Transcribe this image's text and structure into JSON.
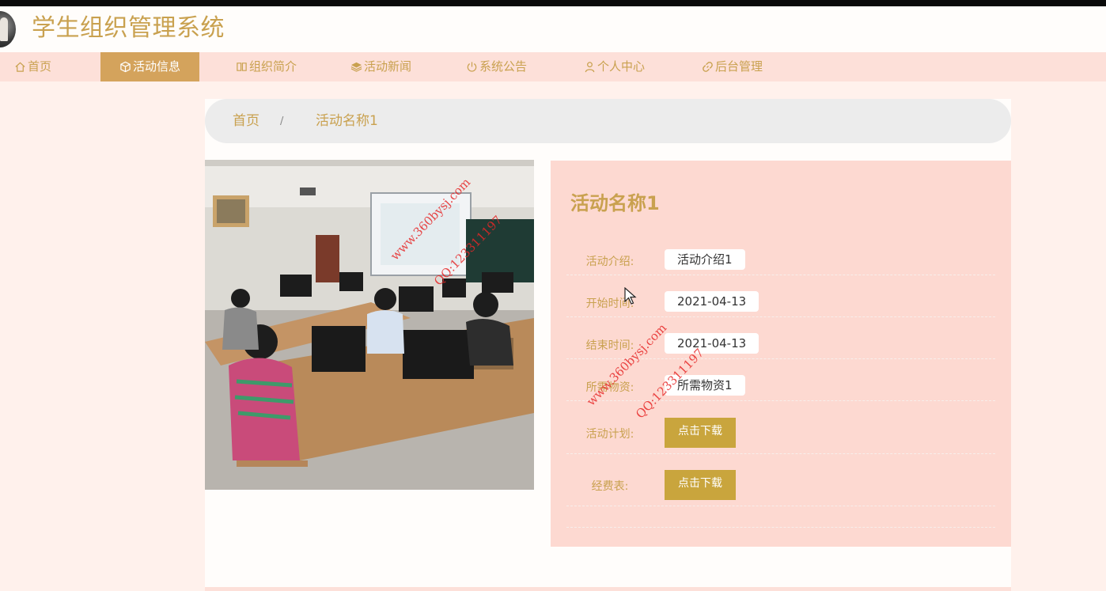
{
  "header": {
    "site_title": "学生组织管理系统"
  },
  "nav": {
    "items": [
      {
        "label": "首页",
        "icon": "home-icon"
      },
      {
        "label": "活动信息",
        "icon": "cube-icon",
        "active": true
      },
      {
        "label": "组织简介",
        "icon": "columns-icon"
      },
      {
        "label": "活动新闻",
        "icon": "layers-icon"
      },
      {
        "label": "系统公告",
        "icon": "power-icon"
      },
      {
        "label": "个人中心",
        "icon": "user-icon"
      },
      {
        "label": "后台管理",
        "icon": "link-icon"
      }
    ]
  },
  "breadcrumb": {
    "home": "首页",
    "separator": "/",
    "current": "活动名称1"
  },
  "detail": {
    "title": "活动名称1",
    "fields": [
      {
        "label": "活动介绍:",
        "value": "活动介绍1"
      },
      {
        "label": "开始时间:",
        "value": "2021-04-13"
      },
      {
        "label": "结束时间:",
        "value": "2021-04-13"
      },
      {
        "label": "所需物资:",
        "value": "所需物资1"
      }
    ],
    "downloads": [
      {
        "label": "活动计划:",
        "button": "点击下载"
      },
      {
        "label": "经费表:",
        "button": "点击下载"
      }
    ]
  },
  "watermarks": [
    {
      "site": "www.360bysj.com",
      "qq": "QQ:123311197"
    },
    {
      "site": "www.360bysj.com",
      "qq": "QQ:123311197"
    }
  ],
  "colors": {
    "accent": "#c9a14f",
    "nav_bg": "#fde0d9",
    "active_tab": "#d4a35c",
    "detail_bg": "#fdd9d1",
    "button": "#c9a53d"
  }
}
